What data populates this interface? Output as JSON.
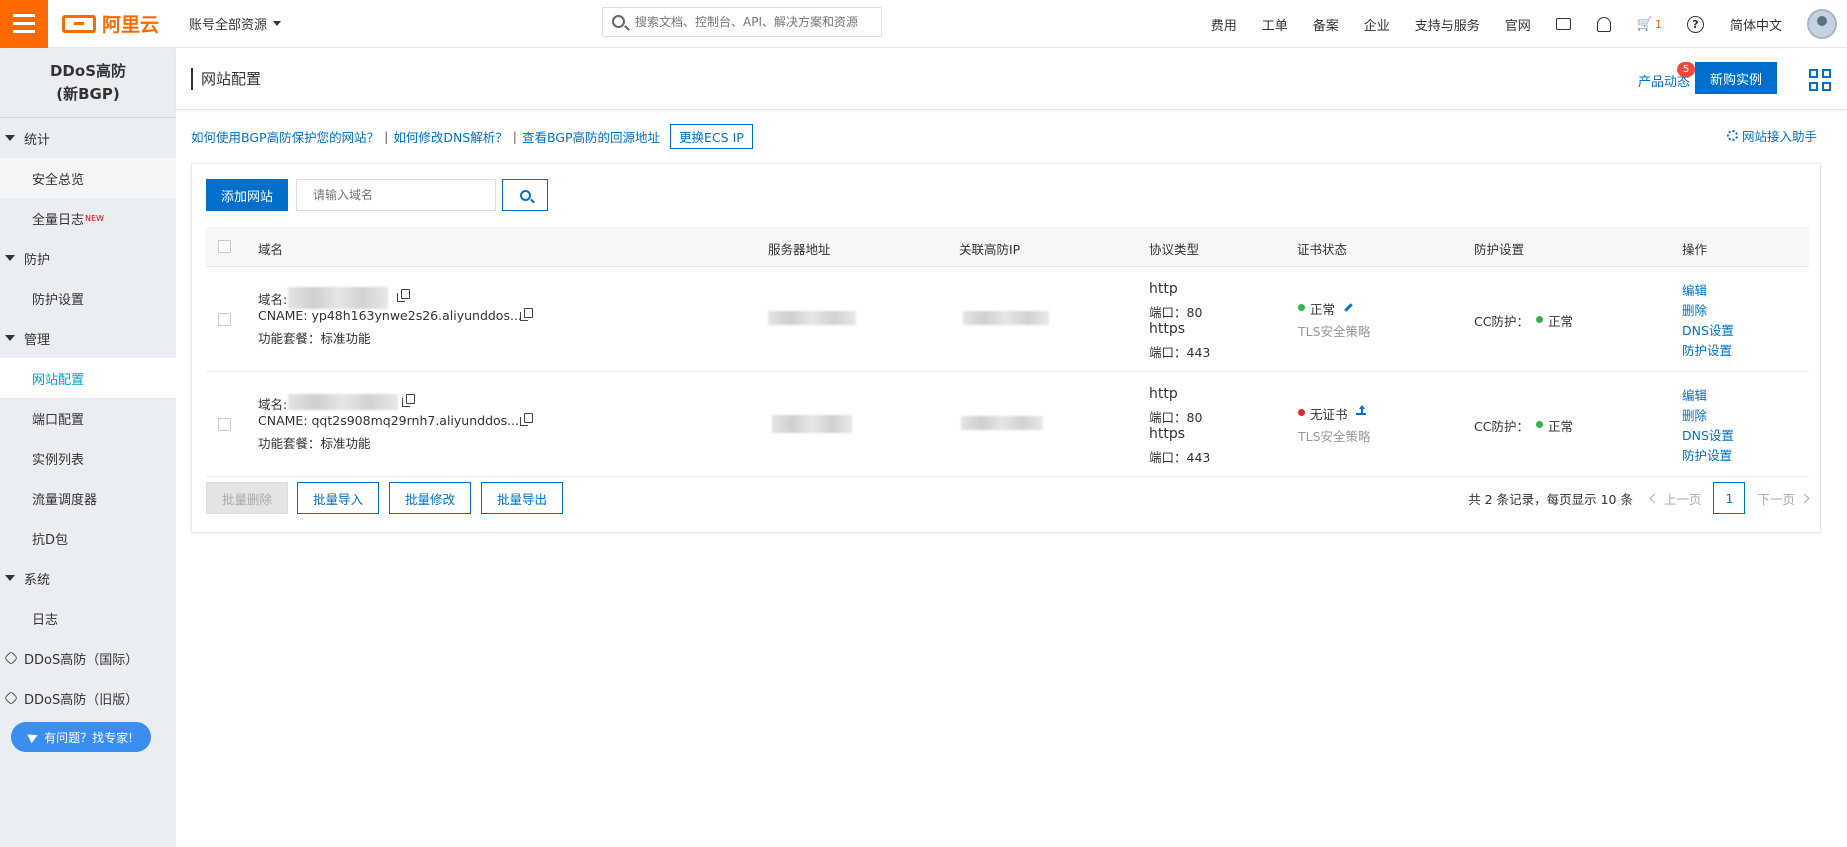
{
  "topbar": {
    "brand": "阿里云",
    "account": "账号全部资源",
    "search_placeholder": "搜索文档、控制台、API、解决方案和资源",
    "nav": [
      "费用",
      "工单",
      "备案",
      "企业",
      "支持与服务",
      "官网"
    ],
    "cart_count": "1",
    "language": "简体中文"
  },
  "sidebar": {
    "title_line1": "DDoS高防",
    "title_line2": "(新BGP)",
    "groups": {
      "stats": "统计",
      "protect": "防护",
      "manage": "管理",
      "system": "系统"
    },
    "items": {
      "security_overview": "安全总览",
      "full_log": "全量日志",
      "full_log_badge": "NEW",
      "protect_settings": "防护设置",
      "site_config": "网站配置",
      "port_config": "端口配置",
      "instance_list": "实例列表",
      "traffic_dispatch": "流量调度器",
      "anti_d": "抗D包",
      "log": "日志"
    },
    "links": {
      "intl": "DDoS高防（国际）",
      "old": "DDoS高防（旧版）"
    },
    "help_button": "有问题？找专家!"
  },
  "page": {
    "title": "网站配置",
    "product_news": "产品动态",
    "news_badge": "5",
    "buy_button": "新购实例"
  },
  "helplinks": {
    "link1": "如何使用BGP高防保护您的网站？",
    "link2": "如何修改DNS解析？",
    "link3": "查看BGP高防的回源地址",
    "ecs_button": "更换ECS IP",
    "assistant": "网站接入助手"
  },
  "toolbar": {
    "add_button": "添加网站",
    "domain_placeholder": "请输入域名"
  },
  "table": {
    "headers": {
      "domain": "域名",
      "server": "服务器地址",
      "ip": "关联高防IP",
      "protocol": "协议类型",
      "cert": "证书状态",
      "protection": "防护设置",
      "ops": "操作"
    },
    "rows": [
      {
        "domain_label": "域名:",
        "cname": "CNAME: yp48h163ynwe2s26.aliyunddos...",
        "package": "功能套餐：标准功能",
        "proto1": "http",
        "port1": "端口：80",
        "proto2": "https",
        "port2": "端口：443",
        "cert_status": "正常",
        "tls": "TLS安全策略",
        "cc": "CC防护：",
        "cc_status": "正常",
        "op_edit": "编辑",
        "op_delete": "删除",
        "op_dns": "DNS设置",
        "op_protect": "防护设置"
      },
      {
        "domain_label": "域名:",
        "cname": "CNAME: qqt2s908mq29rnh7.aliyunddos...",
        "package": "功能套餐：标准功能",
        "proto1": "http",
        "port1": "端口：80",
        "proto2": "https",
        "port2": "端口：443",
        "cert_status": "无证书",
        "tls": "TLS安全策略",
        "cc": "CC防护：",
        "cc_status": "正常",
        "op_edit": "编辑",
        "op_delete": "删除",
        "op_dns": "DNS设置",
        "op_protect": "防护设置"
      }
    ]
  },
  "footer": {
    "batch_delete": "批量删除",
    "batch_import": "批量导入",
    "batch_modify": "批量修改",
    "batch_export": "批量导出",
    "total": "共 2 条记录，每页显示 10 条",
    "prev": "上一页",
    "page": "1",
    "next": "下一页"
  },
  "colors": {
    "brand": "#ff6a00",
    "primary": "#0070cc",
    "sidebar_bg": "#eaedf1",
    "active_text": "#00a2ca",
    "ok": "#35b34a",
    "error": "#e02828"
  }
}
